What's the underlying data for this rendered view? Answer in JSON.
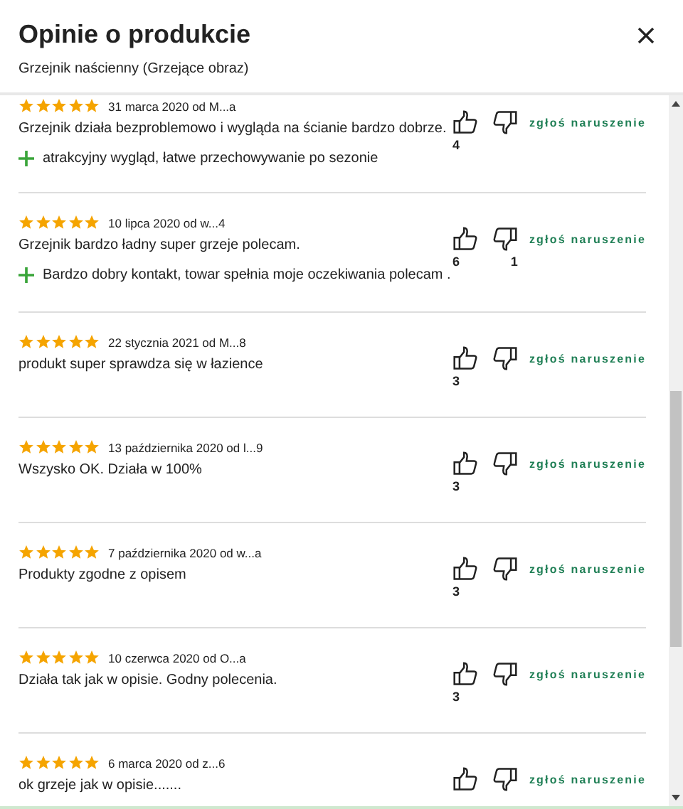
{
  "dialog": {
    "title": "Opinie o produkcie",
    "subtitle": "Grzejnik naścienny (Grzejące obraz)"
  },
  "reviews": [
    {
      "stars": 5,
      "meta": "31 marca 2020 od M...a",
      "text": "Grzejnik działa bezproblemowo i wygląda na ścianie bardzo dobrze.",
      "pros": "atrakcyjny wygląd, łatwe przechowywanie po sezonie",
      "up": "4",
      "report": "zgłoś naruszenie"
    },
    {
      "stars": 5,
      "meta": "10 lipca 2020 od w...4",
      "text": "Grzejnik bardzo ładny super grzeje polecam.",
      "pros": "Bardzo dobry kontakt, towar spełnia moje oczekiwania polecam .",
      "up": "6",
      "down": "1",
      "report": "zgłoś naruszenie"
    },
    {
      "stars": 5,
      "meta": "22 stycznia 2021 od M...8",
      "text": "produkt super sprawdza się w łazience",
      "up": "3",
      "report": "zgłoś naruszenie"
    },
    {
      "stars": 5,
      "meta": "13 października 2020 od l...9",
      "text": "Wszysko OK. Działa w 100%",
      "up": "3",
      "report": "zgłoś naruszenie"
    },
    {
      "stars": 5,
      "meta": "7 października 2020 od w...a",
      "text": "Produkty zgodne z opisem",
      "up": "3",
      "report": "zgłoś naruszenie"
    },
    {
      "stars": 5,
      "meta": "10 czerwca 2020 od O...a",
      "text": "Działa tak jak w opisie. Godny polecenia.",
      "up": "3",
      "report": "zgłoś naruszenie"
    },
    {
      "stars": 5,
      "meta": "6 marca 2020 od z...6",
      "text": "ok grzeje jak w opisie.......",
      "report": "zgłoś naruszenie"
    }
  ]
}
